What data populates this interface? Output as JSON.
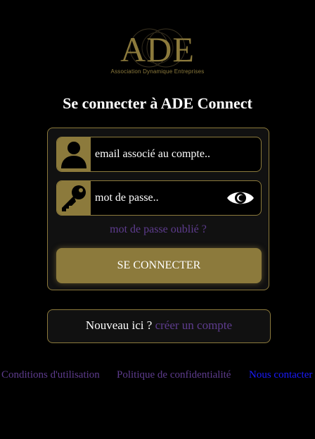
{
  "logo": {
    "text": "ADE",
    "subtitle": "Association Dynamique Entreprises"
  },
  "title": "Se connecter à ADE Connect",
  "login": {
    "email_placeholder": "email associé au compte..",
    "password_placeholder": "mot de passe..",
    "forgot_link": "mot de passe oublié ?",
    "submit_label": "SE CONNECTER"
  },
  "signup": {
    "text": "Nouveau ici ?",
    "link": "créer un compte"
  },
  "footer": {
    "terms": "Conditions d'utilisation",
    "privacy": "Politique de confidentialité",
    "contact": "Nous contacter"
  },
  "icons": {
    "email": "user-icon",
    "password": "key-icon",
    "toggle": "eye-icon"
  },
  "colors": {
    "background": "#000000",
    "gold": "#8c7a3c",
    "link_purple": "#5e3c8e",
    "link_blue": "#1a1aff"
  }
}
